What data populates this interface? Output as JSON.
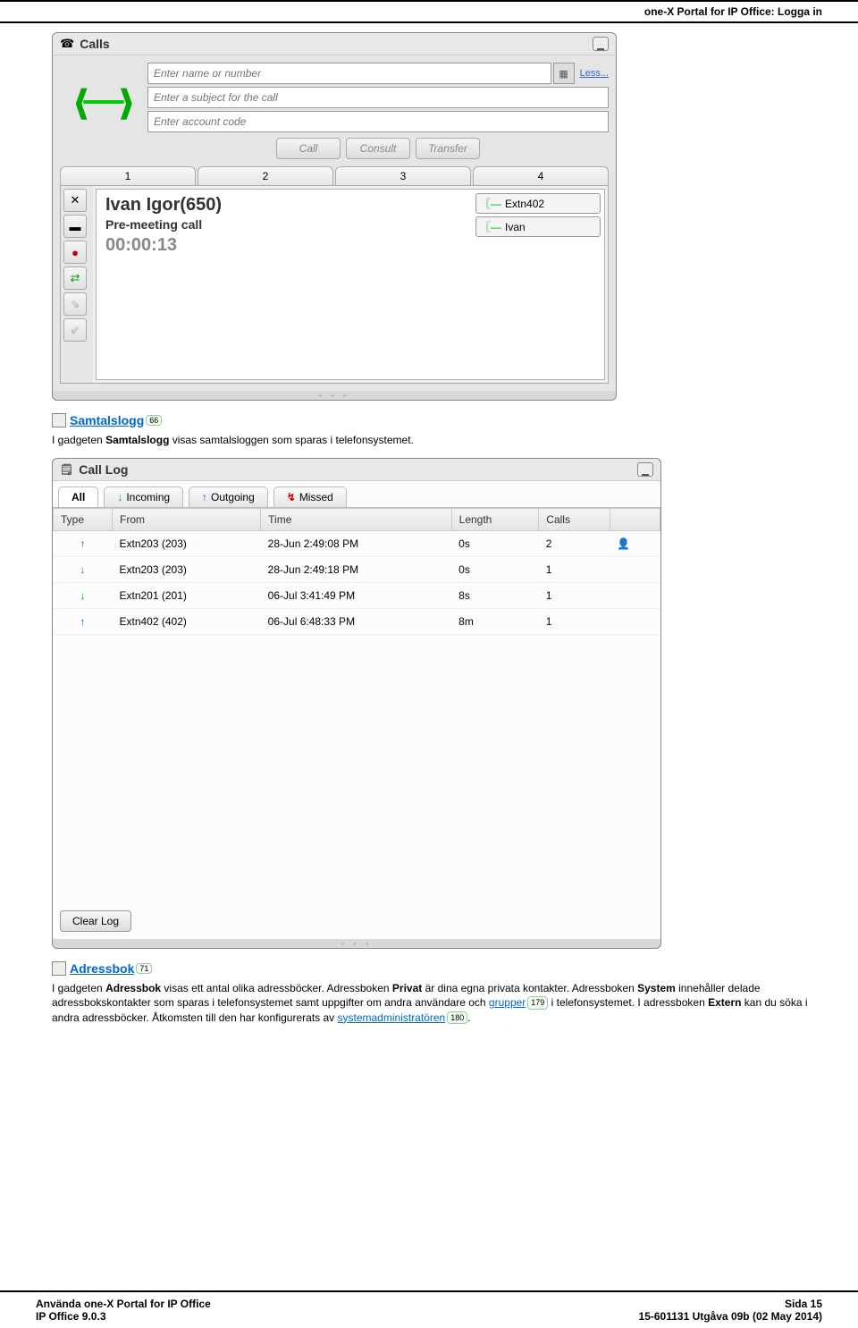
{
  "header": "one-X Portal for IP Office: Logga in",
  "calls": {
    "title": "Calls",
    "name_ph": "Enter name or number",
    "subj_ph": "Enter a subject for the call",
    "acct_ph": "Enter account code",
    "less": "Less...",
    "btn_call": "Call",
    "btn_consult": "Consult",
    "btn_transfer": "Transfer",
    "tabs": [
      "1",
      "2",
      "3",
      "4"
    ],
    "current": {
      "name": "Ivan Igor(650)",
      "subj": "Pre-meeting call",
      "time": "00:00:13"
    },
    "tags": [
      {
        "glyph": "〖—",
        "label": "Extn402"
      },
      {
        "glyph": "〖—",
        "label": "Ivan"
      }
    ]
  },
  "samtalslogg": {
    "icon": "",
    "link": "Samtalslogg",
    "badge": "66",
    "para": {
      "p1": "I gadgeten ",
      "b1": "Samtalslogg",
      "p2": " visas samtalsloggen som sparas i telefonsystemet."
    }
  },
  "calllog": {
    "title": "Call Log",
    "tabs": [
      {
        "label": "All",
        "cls": "active",
        "glyph": ""
      },
      {
        "label": "Incoming",
        "cls": "",
        "glyph": "↓",
        "gcls": "ar-dn"
      },
      {
        "label": "Outgoing",
        "cls": "",
        "glyph": "↑",
        "gcls": "ar-up"
      },
      {
        "label": "Missed",
        "cls": "",
        "glyph": "↯",
        "gcls": "ar-ms"
      }
    ],
    "cols": [
      "Type",
      "From",
      "Time",
      "Length",
      "Calls",
      ""
    ],
    "rows": [
      {
        "t": "↑",
        "tc": "ar-up",
        "from": "Extn203 (203)",
        "time": "28-Jun 2:49:08 PM",
        "len": "0s",
        "calls": "2",
        "extra": "👤"
      },
      {
        "t": "↓",
        "tc": "ar-dn",
        "from": "Extn203 (203)",
        "time": "28-Jun 2:49:18 PM",
        "len": "0s",
        "calls": "1",
        "extra": ""
      },
      {
        "t": "↓",
        "tc": "ar-dn",
        "from": "Extn201 (201)",
        "time": "06-Jul 3:41:49 PM",
        "len": "8s",
        "calls": "1",
        "extra": ""
      },
      {
        "t": "↑",
        "tc": "ar-up",
        "from": "Extn402 (402)",
        "time": "06-Jul 6:48:33 PM",
        "len": "8m",
        "calls": "1",
        "extra": ""
      }
    ],
    "clear": "Clear Log"
  },
  "adressbok": {
    "link": "Adressbok",
    "badge": "71",
    "para_parts": {
      "a": "I gadgeten ",
      "b": "Adressbok",
      "c": " visas ett antal olika adressböcker. Adressboken ",
      "d": "Privat",
      "e": " är dina egna privata kontakter. Adressboken ",
      "f": "System",
      "g": " innehåller delade adressbokskontakter som sparas i telefonsystemet samt uppgifter om andra användare och ",
      "h": "grupper",
      "hb": "179",
      "i": " i telefonsystemet. I adressboken ",
      "j": "Extern",
      "k": " kan du söka i andra adressböcker. Åtkomsten till den har konfigurerats av ",
      "l": "systemadministratören",
      "lb": "180",
      "m": "."
    }
  },
  "footer": {
    "l1": "Använda one-X Portal for IP Office",
    "l2": "IP Office 9.0.3",
    "r1": "Sida 15",
    "r2": "15-601131 Utgåva 09b (02 May 2014)"
  }
}
